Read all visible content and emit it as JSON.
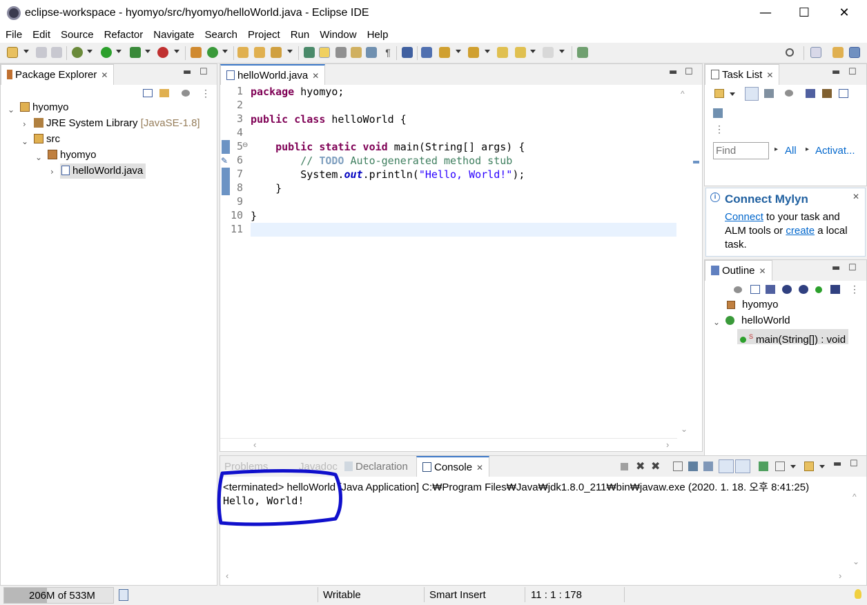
{
  "window": {
    "title": "eclipse-workspace - hyomyo/src/hyomyo/helloWorld.java - Eclipse IDE",
    "minimize": "—",
    "maximize": "☐",
    "close": "✕"
  },
  "menu": [
    "File",
    "Edit",
    "Source",
    "Refactor",
    "Navigate",
    "Search",
    "Project",
    "Run",
    "Window",
    "Help"
  ],
  "package_explorer": {
    "tab_label": "Package Explorer",
    "tree": [
      {
        "label": "hyomyo",
        "icon": "project-folder-icon",
        "extra": ""
      },
      {
        "label": "JRE System Library",
        "icon": "library-icon",
        "extra": "[JavaSE-1.8]"
      },
      {
        "label": "src",
        "icon": "source-folder-icon",
        "extra": ""
      },
      {
        "label": "hyomyo",
        "icon": "package-icon",
        "extra": ""
      },
      {
        "label": "helloWorld.java",
        "icon": "java-file-icon",
        "extra": ""
      }
    ]
  },
  "editor": {
    "tab_label": "helloWorld.java",
    "line_numbers": [
      "1",
      "2",
      "3",
      "4",
      "5",
      "6",
      "7",
      "8",
      "9",
      "10",
      "11"
    ],
    "code": {
      "l1_kw": "package",
      "l1_rest": " hyomyo;",
      "l3_kw": "public class",
      "l3_rest": " helloWorld {",
      "l5_indent": "    ",
      "l5_kw": "public static void",
      "l5_rest": " main(String[] args) {",
      "l6_indent": "        ",
      "l6_cm1": "// ",
      "l6_todo": "TODO",
      "l6_cm2": " Auto-generated method stub",
      "l7_indent": "        ",
      "l7_a": "System.",
      "l7_field": "out",
      "l7_b": ".println(",
      "l7_str": "\"Hello, World!\"",
      "l7_c": ");",
      "l8": "    }",
      "l10": "}"
    }
  },
  "task_list": {
    "tab_label": "Task List",
    "find_placeholder": "Find",
    "all_label": "All",
    "activate_label": "Activat..."
  },
  "mylyn": {
    "title": "Connect Mylyn",
    "connect_link": "Connect",
    "text1": " to your task and",
    "text2": "ALM tools or ",
    "create_link": "create",
    "text3": " a local",
    "text4": "task."
  },
  "outline": {
    "tab_label": "Outline",
    "items": [
      "hyomyo",
      "helloWorld",
      "main(String[]) : void"
    ]
  },
  "bottom": {
    "tabs": [
      "Problems",
      "Javadoc",
      "Declaration",
      "Console"
    ],
    "console_header": "<terminated> helloWorld [Java Application] C:₩Program Files₩Java₩jdk1.8.0_211₩bin₩javaw.exe (2020. 1. 18. 오후 8:41:25)",
    "console_output": "Hello, World!"
  },
  "status": {
    "memory": "206M of 533M",
    "writable": "Writable",
    "insert_mode": "Smart Insert",
    "position": "11 : 1 : 178"
  },
  "colors": {
    "keyword": "#7f0055",
    "comment": "#3f7f5f",
    "string": "#2a00ff",
    "annotation_circle": "#1010cc"
  }
}
